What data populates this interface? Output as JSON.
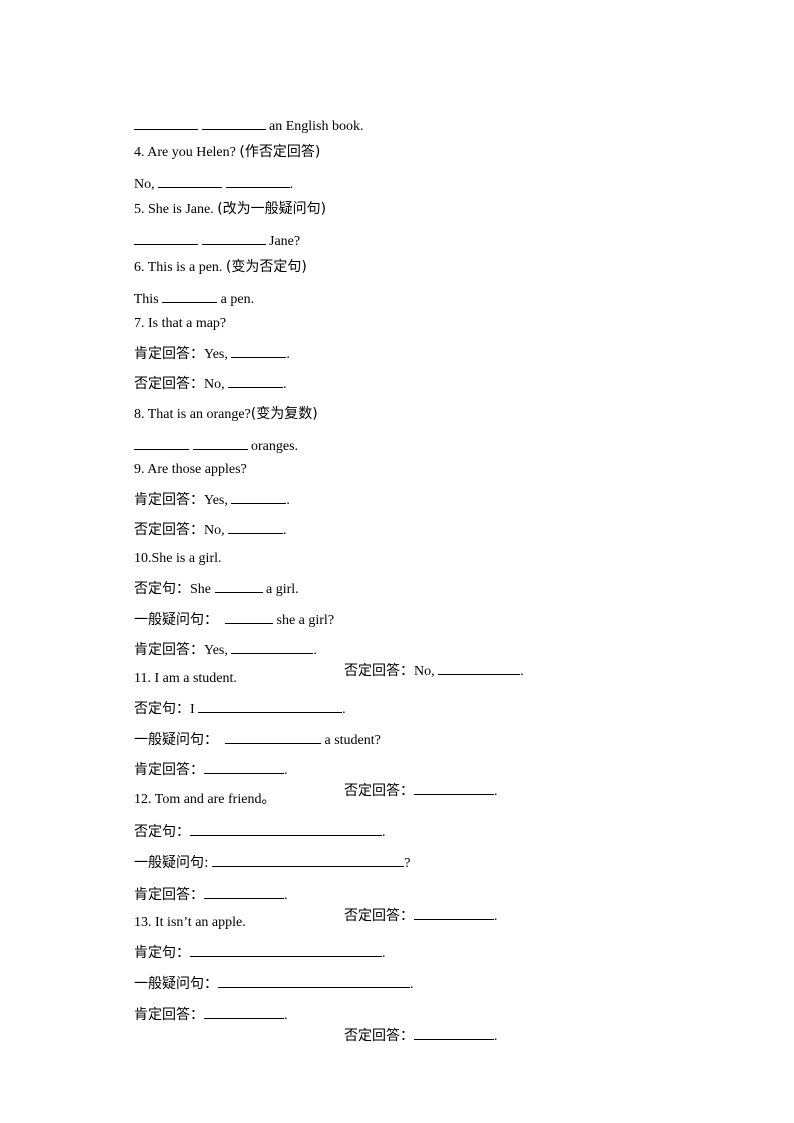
{
  "lines": {
    "l0": {
      "after": " an English book."
    },
    "q4": {
      "text": "4. Are you Helen? ",
      "note": "(作否定回答)"
    },
    "q4a": {
      "prefix": "No, ",
      "suffix": "."
    },
    "q5": {
      "text": "5. She is Jane. ",
      "note": "(改为一般疑问句)"
    },
    "q5a": {
      "suffix": " Jane?"
    },
    "q6": {
      "text": "6. This is a pen. ",
      "note": "(变为否定句)"
    },
    "q6a": {
      "prefix": "This ",
      "suffix": " a pen."
    },
    "q7": {
      "text": "7. Is that a map?"
    },
    "q7y": {
      "label": "肯定回答：",
      "prefix": "Yes, ",
      "suffix": "."
    },
    "q7n": {
      "label": "否定回答：",
      "prefix": "No, ",
      "suffix": "."
    },
    "q8": {
      "text": "8. That is an orange?",
      "note": "(变为复数)"
    },
    "q8a": {
      "suffix": " oranges."
    },
    "q9": {
      "text": "9. Are those apples?"
    },
    "q9y": {
      "label": "肯定回答：",
      "prefix": "Yes, ",
      "suffix": "."
    },
    "q9n": {
      "label": "否定回答：",
      "prefix": "No, ",
      "suffix": "."
    },
    "q10": {
      "text": "10.She is a girl."
    },
    "q10neg": {
      "label": "否定句：",
      "prefix": "She ",
      "suffix": " a girl."
    },
    "q10q": {
      "label": "一般疑问句：",
      "suffix": " she a girl?"
    },
    "q10y": {
      "label": "肯定回答：",
      "prefix": "Yes, ",
      "suffix": "."
    },
    "q10n": {
      "label": "否定回答：",
      "prefix": "No, ",
      "suffix": "."
    },
    "q11": {
      "text": "11. I am a student."
    },
    "q11neg": {
      "label": "否定句：",
      "prefix": "I ",
      "suffix": "."
    },
    "q11q": {
      "label": "一般疑问句：",
      "suffix": " a student?"
    },
    "q11y": {
      "label": "肯定回答：",
      "suffix": "."
    },
    "q11n": {
      "label": "否定回答：",
      "suffix": "."
    },
    "q12": {
      "text": "12. Tom and are friend。"
    },
    "q12neg": {
      "label": "否定句：",
      "suffix": "."
    },
    "q12q": {
      "label": "一般疑问句:",
      "suffix": "?"
    },
    "q12y": {
      "label": "肯定回答：",
      "suffix": "."
    },
    "q12n": {
      "label": "否定回答：",
      "suffix": "."
    },
    "q13": {
      "text": "13. It isn’t an apple."
    },
    "q13pos": {
      "label": "肯定句：",
      "suffix": "."
    },
    "q13q": {
      "label": "一般疑问句：",
      "suffix": "."
    },
    "q13y": {
      "label": "肯定回答：",
      "suffix": "."
    },
    "q13n": {
      "label": "否定回答：",
      "suffix": "."
    }
  }
}
